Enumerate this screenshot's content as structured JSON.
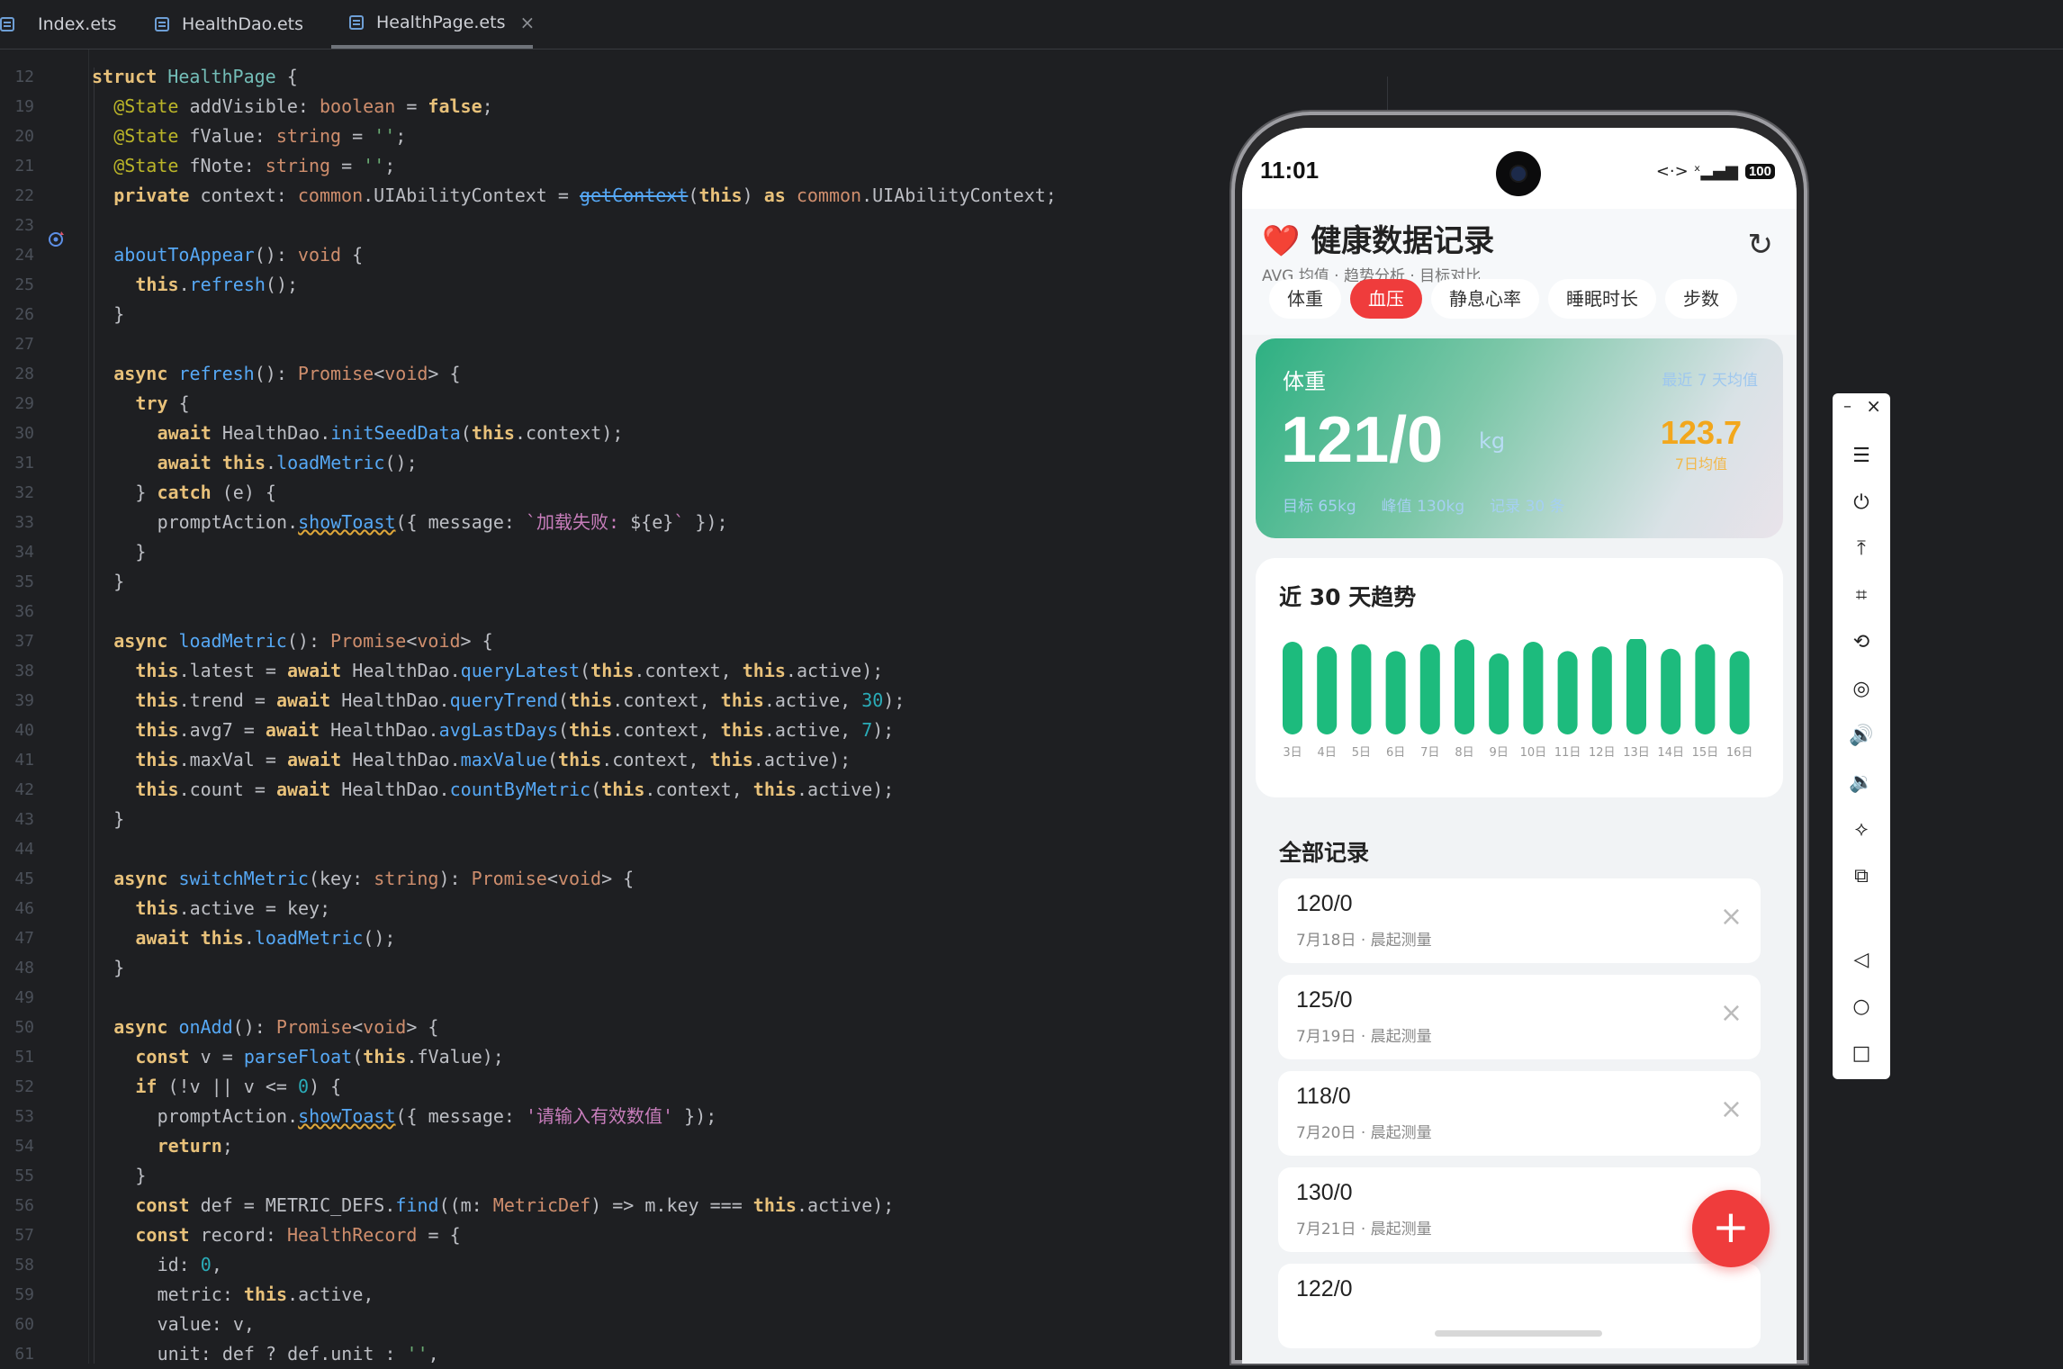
{
  "ide": {
    "tabs": [
      {
        "label": "Index.ets"
      },
      {
        "label": "HealthDao.ets"
      },
      {
        "label": "HealthPage.ets",
        "close": "×"
      }
    ],
    "line_numbers": [
      "12",
      "19",
      "20",
      "21",
      "22",
      "23",
      "24",
      "25",
      "26",
      "27",
      "28",
      "29",
      "30",
      "31",
      "32",
      "33",
      "34",
      "35",
      "36",
      "37",
      "38",
      "39",
      "40",
      "41",
      "42",
      "43",
      "44",
      "45",
      "46",
      "47",
      "48",
      "49",
      "50",
      "51",
      "52",
      "53",
      "54",
      "55",
      "56",
      "57",
      "58",
      "59",
      "60",
      "61"
    ]
  },
  "phone": {
    "status": {
      "time": "11:01",
      "signal_glyph": "<·> ˣ▂▄▆",
      "battery": "100"
    },
    "header": {
      "icon": "❤️",
      "title": "健康数据记录",
      "subtitle": "AVG 均值 · 趋势分析 · 目标对比",
      "refresh_glyph": "↻"
    },
    "chips": [
      "体重",
      "血压",
      "静息心率",
      "睡眠时长",
      "步数"
    ],
    "active_chip": "血压",
    "summary": {
      "name": "体重",
      "hint": "最近 7 天均值",
      "value": "121/0",
      "unit": "kg",
      "avg": "123.7",
      "avg_label": "7日均值",
      "goal": "目标 65kg",
      "peak": "峰值 130kg",
      "count": "记录 30 条"
    },
    "trend": {
      "title": "近 30 天趋势"
    },
    "records": {
      "title": "全部记录",
      "items": [
        {
          "value": "120/0",
          "date": "7月18日 · 晨起测量"
        },
        {
          "value": "125/0",
          "date": "7月19日 · 晨起测量"
        },
        {
          "value": "118/0",
          "date": "7月20日 · 晨起测量"
        },
        {
          "value": "130/0",
          "date": "7月21日 · 晨起测量"
        },
        {
          "value": "122/0",
          "date": ""
        }
      ],
      "delete_glyph": "×"
    },
    "fab": "+"
  },
  "emulator_tools": {
    "min": "–",
    "close": "×",
    "items": [
      "menu-icon",
      "power-icon",
      "upload-icon",
      "crop-icon",
      "rotate-icon",
      "screenshot-icon",
      "volume-up-icon",
      "volume-down-icon",
      "shake-icon",
      "multi-device-icon",
      "back-icon",
      "home-icon",
      "recents-icon"
    ]
  },
  "colors": {
    "accent_red": "#ef3c3c",
    "bar_green": "#1dbb7d",
    "avg_orange": "#f2a71c"
  },
  "chart_data": {
    "type": "bar",
    "categories": [
      "3日",
      "4日",
      "5日",
      "6日",
      "7日",
      "8日",
      "9日",
      "10日",
      "11日",
      "12日",
      "13日",
      "14日",
      "15日",
      "16日"
    ],
    "values": [
      121,
      119,
      120,
      117,
      120,
      122,
      116,
      121,
      117,
      119,
      123,
      118,
      120,
      117
    ],
    "title": "近 30 天趋势",
    "xlabel": "",
    "ylabel": "",
    "ylim": [
      0,
      125
    ],
    "grid": false
  }
}
